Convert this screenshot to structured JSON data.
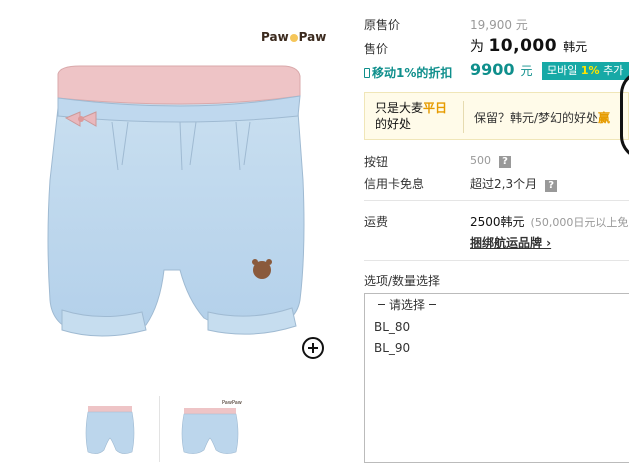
{
  "brand": {
    "logo_text_left": "Paw",
    "logo_text_right": "Paw"
  },
  "gallery": {
    "zoom_icon": "zoom-plus-icon",
    "thumbnails": [
      {
        "name": "thumb-front"
      },
      {
        "name": "thumb-alt"
      }
    ]
  },
  "price": {
    "original_label": "原售价",
    "original_value": "19,900 元",
    "sale_label": "售价",
    "sale_prefix": "为",
    "sale_amount": "10,000",
    "sale_unit": "韩元",
    "mobile_label": "移动1%的折扣",
    "mobile_amount": "9900",
    "mobile_unit": "元",
    "mobile_badge_prefix": "모바일",
    "mobile_badge_highlight": "1%",
    "mobile_badge_suffix": "추가"
  },
  "promo": {
    "left_line1_prefix": "只是大麦",
    "left_line1_highlight": "平日",
    "left_line2": "的好处",
    "right_text": "保留？韩元/梦幻的好处",
    "right_highlight": "赢"
  },
  "points": {
    "label": "按钮",
    "value": "500",
    "help": "?"
  },
  "card": {
    "label": "信用卡免息",
    "value": "超过2,3个月",
    "help": "?"
  },
  "shipping": {
    "label": "运费",
    "value": "2500韩元",
    "note": "(50,000日元以上免",
    "link": "捆绑航运品牌 ›"
  },
  "options": {
    "title": "选项/数量选择",
    "placeholder": "请选择",
    "items": [
      "BL_80",
      "BL_90"
    ]
  },
  "colors": {
    "teal": "#0f8f8c",
    "badge": "#17a9a6",
    "highlight_orange": "#e69b00",
    "promo_bg": "#fffbe9"
  }
}
